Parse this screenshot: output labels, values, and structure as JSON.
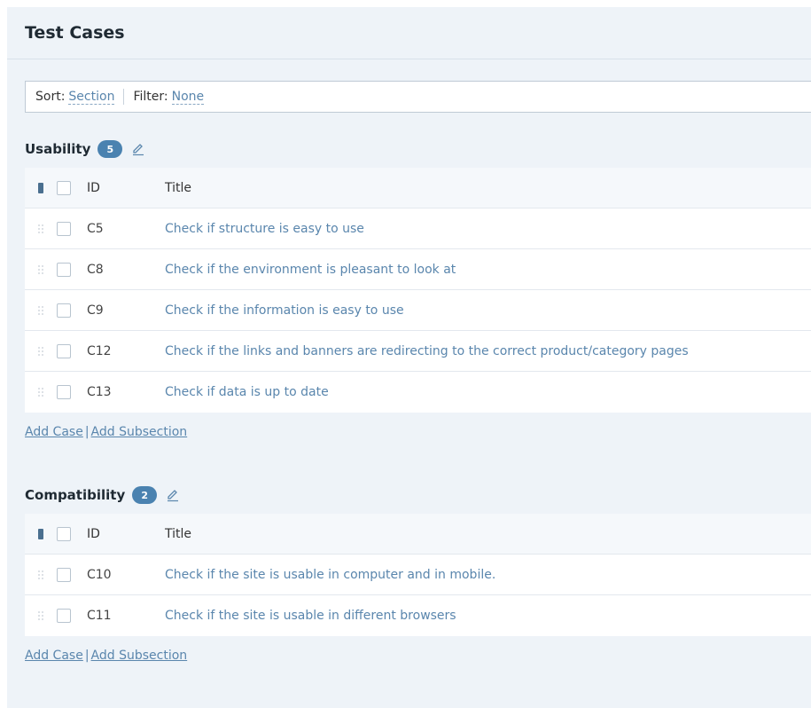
{
  "header": {
    "title": "Test Cases"
  },
  "toolbar": {
    "sort_label": "Sort:",
    "sort_value": "Section",
    "filter_label": "Filter:",
    "filter_value": "None"
  },
  "columns": {
    "id": "ID",
    "title": "Title"
  },
  "actions": {
    "add_case": "Add Case",
    "separator": "|",
    "add_subsection": "Add Subsection"
  },
  "sections": [
    {
      "name": "Usability",
      "count": "5",
      "cases": [
        {
          "id": "C5",
          "title": "Check if structure is easy to use"
        },
        {
          "id": "C8",
          "title": "Check if the environment is pleasant to look at"
        },
        {
          "id": "C9",
          "title": "Check if the information is easy to use"
        },
        {
          "id": "C12",
          "title": "Check if the links and banners are redirecting to the correct product/category pages"
        },
        {
          "id": "C13",
          "title": "Check if data is up to date"
        }
      ]
    },
    {
      "name": "Compatibility",
      "count": "2",
      "cases": [
        {
          "id": "C10",
          "title": "Check if the site is usable in computer and in mobile."
        },
        {
          "id": "C11",
          "title": "Check if the site is usable in different browsers"
        }
      ]
    }
  ],
  "colors": {
    "link": "#5a86ad",
    "badge": "#4a82b0",
    "panel": "#eef3f8"
  }
}
